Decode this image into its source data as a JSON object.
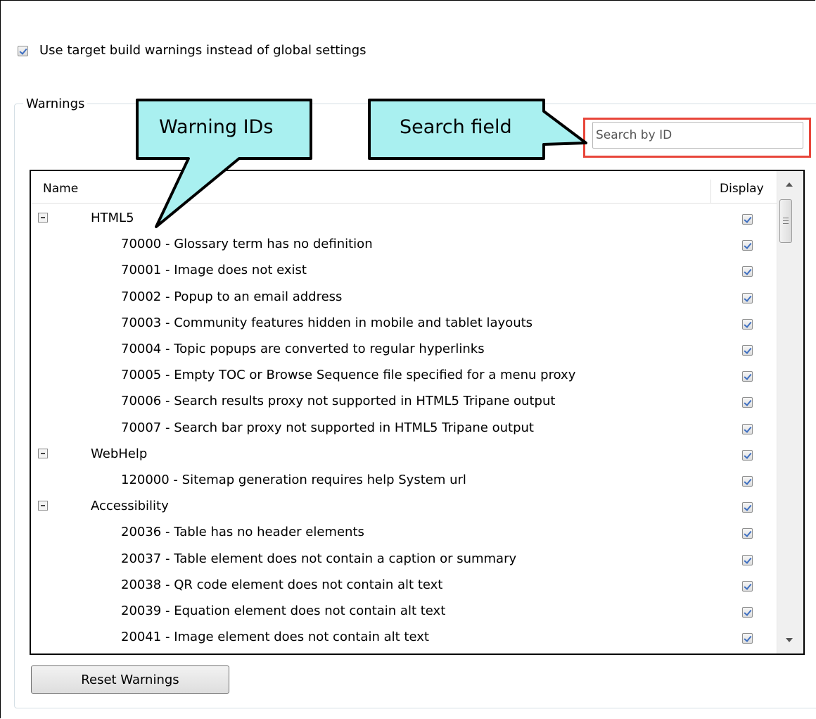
{
  "use_target_label": "Use target build warnings instead of global settings",
  "groupbox_title": "Warnings",
  "search": {
    "placeholder": "Search by ID",
    "value": ""
  },
  "callouts": {
    "warning_ids": "Warning IDs",
    "search_field": "Search field"
  },
  "table": {
    "columns": {
      "name": "Name",
      "display": "Display"
    },
    "rows": [
      {
        "type": "group",
        "label": "HTML5",
        "display": true
      },
      {
        "type": "item",
        "label": "70000 - Glossary term has no definition",
        "display": true
      },
      {
        "type": "item",
        "label": "70001 - Image does not exist",
        "display": true
      },
      {
        "type": "item",
        "label": "70002 - Popup to an email address",
        "display": true
      },
      {
        "type": "item",
        "label": "70003 - Community features hidden in mobile and tablet layouts",
        "display": true
      },
      {
        "type": "item",
        "label": "70004 - Topic popups are converted to regular hyperlinks",
        "display": true
      },
      {
        "type": "item",
        "label": "70005 - Empty TOC or Browse Sequence file specified for a menu proxy",
        "display": true
      },
      {
        "type": "item",
        "label": "70006 - Search results proxy not supported in HTML5 Tripane output",
        "display": true
      },
      {
        "type": "item",
        "label": "70007 - Search bar proxy not supported in HTML5 Tripane output",
        "display": true
      },
      {
        "type": "group",
        "label": "WebHelp",
        "display": true
      },
      {
        "type": "item",
        "label": "120000 - Sitemap generation requires help System url",
        "display": true
      },
      {
        "type": "group",
        "label": "Accessibility",
        "display": true
      },
      {
        "type": "item",
        "label": "20036 - Table has no header elements",
        "display": true
      },
      {
        "type": "item",
        "label": "20037 - Table element does not contain a caption or summary",
        "display": true
      },
      {
        "type": "item",
        "label": "20038 - QR code element does not contain alt text",
        "display": true
      },
      {
        "type": "item",
        "label": "20039 - Equation element does not contain alt text",
        "display": true
      },
      {
        "type": "item",
        "label": "20041 - Image element does not contain alt text",
        "display": true
      }
    ]
  },
  "reset_button_label": "Reset Warnings",
  "colors": {
    "callout_fill": "#a9f0f0",
    "search_highlight": "#e8463a",
    "checkmark": "#3d6ec0"
  }
}
